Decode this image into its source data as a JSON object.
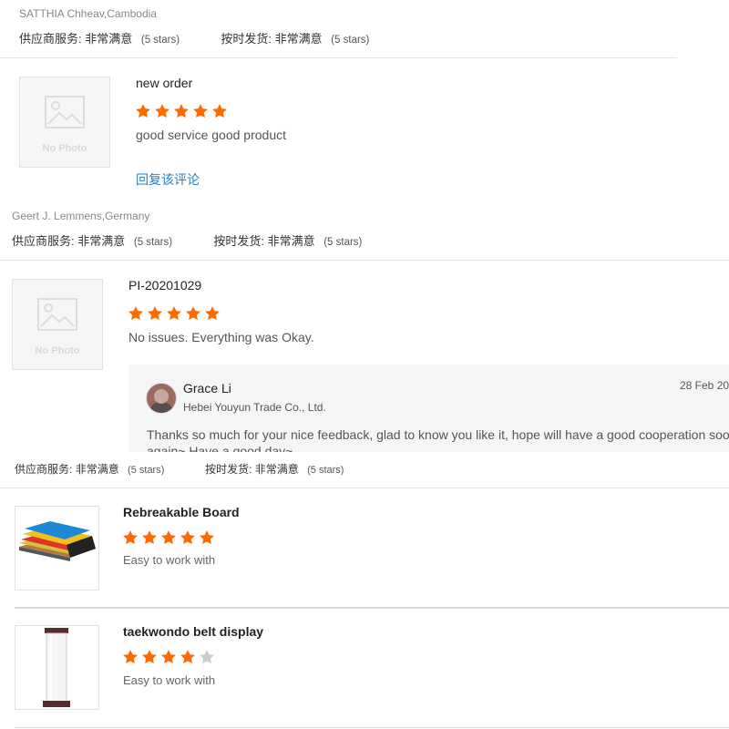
{
  "reviews": [
    {
      "reviewer": "SATTHIA Chheav,Cambodia",
      "supplier_service_label": "供应商服务:",
      "supplier_service_value": "非常满意",
      "supplier_service_stars": "(5 stars)",
      "ontime_label": "按时发货:",
      "ontime_value": "非常满意",
      "ontime_stars": "(5 stars)",
      "product_title": "new order",
      "rating": 5,
      "image_placeholder": "No Photo",
      "comment": "good service good product",
      "reply_link": "回复该评论"
    },
    {
      "reviewer": "Geert J. Lemmens,Germany",
      "supplier_service_label": "供应商服务:",
      "supplier_service_value": "非常满意",
      "supplier_service_stars": "(5 stars)",
      "ontime_label": "按时发货:",
      "ontime_value": "非常满意",
      "ontime_stars": "(5 stars)",
      "product_title": "PI-20201029",
      "rating": 5,
      "image_placeholder": "No Photo",
      "comment": "No issues. Everything was Okay.",
      "reply": {
        "name": "Grace Li",
        "company": "Hebei Youyun Trade Co., Ltd.",
        "date": "28 Feb 20",
        "text_line1": "Thanks so much for your nice feedback, glad to know you  like it, hope will have a good cooperation soon",
        "text_line2": "again~ Have a good day~"
      }
    },
    {
      "supplier_service_label": "供应商服务:",
      "supplier_service_value": "非常满意",
      "supplier_service_stars": "(5 stars)",
      "ontime_label": "按时发货:",
      "ontime_value": "非常满意",
      "ontime_stars": "(5 stars)",
      "products": [
        {
          "title": "Rebreakable Board",
          "rating": 5,
          "comment": "Easy to work with",
          "image": "rebreakable-board-image"
        },
        {
          "title": "taekwondo belt display",
          "rating": 4,
          "comment": "Easy to work with",
          "image": "belt-display-tube-image"
        }
      ]
    }
  ],
  "colors": {
    "star": "#ff6a00",
    "star_empty": "#cccccc",
    "link": "#2a7fc2"
  }
}
